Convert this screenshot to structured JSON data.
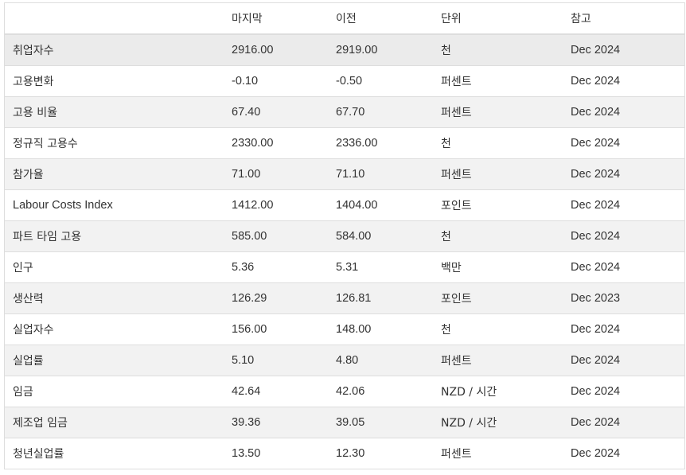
{
  "table": {
    "headers": {
      "name": "",
      "last": "마지막",
      "previous": "이전",
      "unit": "단위",
      "reference": "참고"
    },
    "rows": [
      {
        "name": "취업자수",
        "last": "2916.00",
        "previous": "2919.00",
        "unit": "천",
        "reference": "Dec 2024"
      },
      {
        "name": "고용변화",
        "last": "-0.10",
        "previous": "-0.50",
        "unit": "퍼센트",
        "reference": "Dec 2024"
      },
      {
        "name": "고용 비율",
        "last": "67.40",
        "previous": "67.70",
        "unit": "퍼센트",
        "reference": "Dec 2024"
      },
      {
        "name": "정규직 고용수",
        "last": "2330.00",
        "previous": "2336.00",
        "unit": "천",
        "reference": "Dec 2024"
      },
      {
        "name": "참가율",
        "last": "71.00",
        "previous": "71.10",
        "unit": "퍼센트",
        "reference": "Dec 2024"
      },
      {
        "name": "Labour Costs Index",
        "last": "1412.00",
        "previous": "1404.00",
        "unit": "포인트",
        "reference": "Dec 2024"
      },
      {
        "name": "파트 타임 고용",
        "last": "585.00",
        "previous": "584.00",
        "unit": "천",
        "reference": "Dec 2024"
      },
      {
        "name": "인구",
        "last": "5.36",
        "previous": "5.31",
        "unit": "백만",
        "reference": "Dec 2024"
      },
      {
        "name": "생산력",
        "last": "126.29",
        "previous": "126.81",
        "unit": "포인트",
        "reference": "Dec 2023"
      },
      {
        "name": "실업자수",
        "last": "156.00",
        "previous": "148.00",
        "unit": "천",
        "reference": "Dec 2024"
      },
      {
        "name": "실업률",
        "last": "5.10",
        "previous": "4.80",
        "unit": "퍼센트",
        "reference": "Dec 2024"
      },
      {
        "name": "임금",
        "last": "42.64",
        "previous": "42.06",
        "unit": "NZD / 시간",
        "reference": "Dec 2024"
      },
      {
        "name": "제조업 임금",
        "last": "39.36",
        "previous": "39.05",
        "unit": "NZD / 시간",
        "reference": "Dec 2024"
      },
      {
        "name": "청년실업률",
        "last": "13.50",
        "previous": "12.30",
        "unit": "퍼센트",
        "reference": "Dec 2024"
      }
    ]
  }
}
